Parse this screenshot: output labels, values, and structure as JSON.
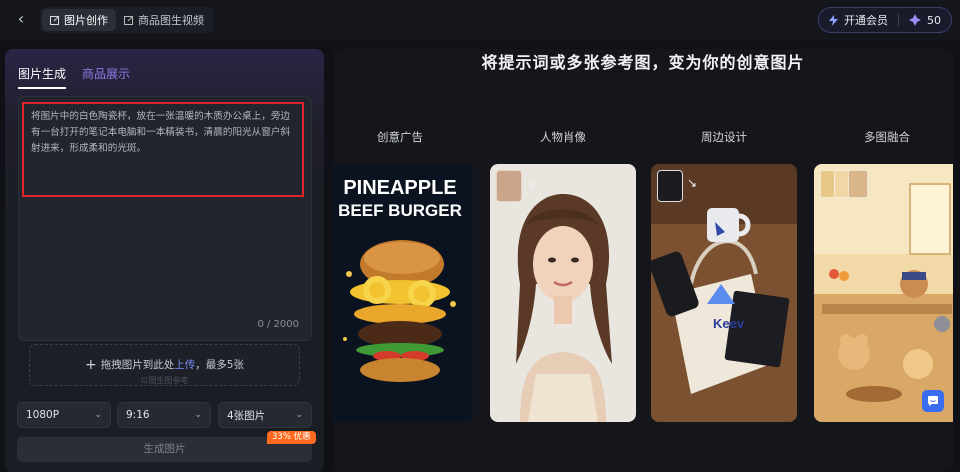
{
  "topbar": {
    "tabs": [
      {
        "label": "图片创作",
        "icon": "edit-icon"
      },
      {
        "label": "商品图生视频",
        "icon": "edit-icon"
      }
    ],
    "vip_label": "开通会员",
    "credits": "50"
  },
  "left": {
    "tabs": [
      "图片生成",
      "商品展示"
    ],
    "prompt": "将图片中的白色陶瓷杯，放在一张温暖的木质办公桌上，旁边有一台打开的笔记本电脑和一本精装书，清晨的阳光从窗户斜射进来，形成柔和的光斑。",
    "counter": "0 / 2000",
    "upload": {
      "prefix": "拖拽图片到此处",
      "link": "上传",
      "suffix": "，最多5张",
      "sub": "以图生图参考"
    },
    "resolution": "1080P",
    "ratio": "9:16",
    "count": "4张图片",
    "generate_label": "生成图片",
    "discount_badge": "33% 优惠"
  },
  "right": {
    "headline": "将提示词或多张参考图，变为你的创意图片",
    "categories": [
      "创意广告",
      "人物肖像",
      "周边设计",
      "多图融合"
    ],
    "burger_title_1": "PINEAPPLE",
    "burger_title_2": "BEEF BURGER",
    "brand_text": "Keev"
  },
  "colors": {
    "accent": "#7d8cff",
    "highlight": "#e0262a",
    "badge": "#ff6a1f",
    "chat": "#3a6cf0"
  }
}
